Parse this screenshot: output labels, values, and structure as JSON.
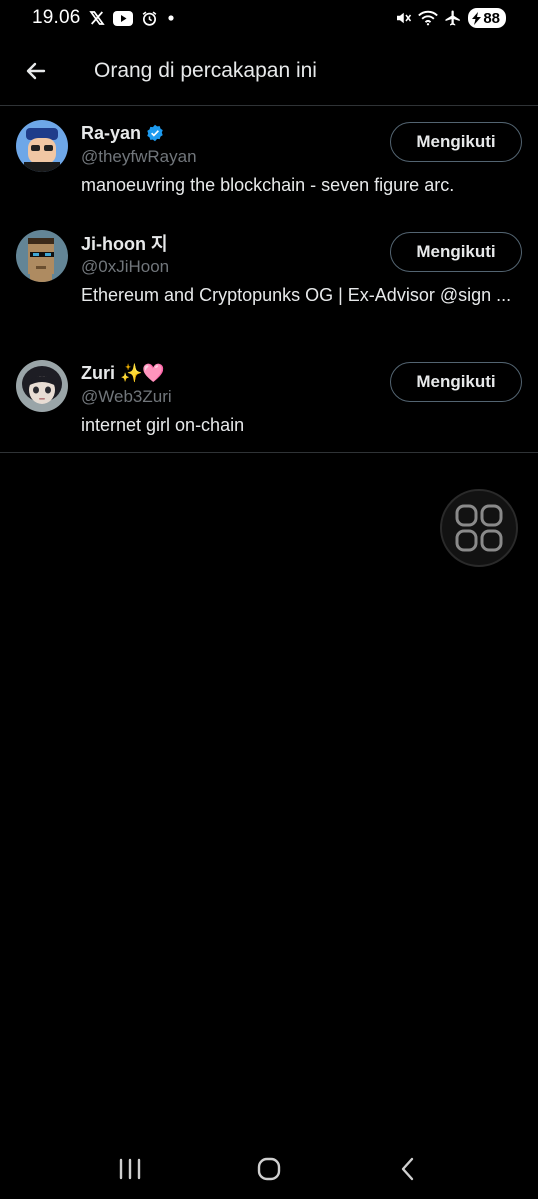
{
  "status_bar": {
    "time": "19.06",
    "battery": "88",
    "icons": [
      "x-icon",
      "youtube-icon",
      "alarm-icon",
      "dot-icon",
      "mute-icon",
      "wifi-icon",
      "airplane-icon",
      "battery-icon"
    ]
  },
  "header": {
    "title": "Orang di percakapan ini"
  },
  "users": [
    {
      "name": "Ra-yan",
      "verified": true,
      "handle": "@theyfwRayan",
      "bio": "manoeuvring the blockchain - seven figure arc.",
      "follow_label": "Mengikuti"
    },
    {
      "name": "Ji-hoon 지",
      "verified": false,
      "handle": "@0xJiHoon",
      "bio": "Ethereum and Cryptopunks OG |  Ex-Advisor @sign ...",
      "follow_label": "Mengikuti"
    },
    {
      "name": "Zuri ✨🩷",
      "verified": false,
      "handle": "@Web3Zuri",
      "bio": "internet girl on-chain",
      "follow_label": "Mengikuti"
    }
  ],
  "colors": {
    "background": "#000000",
    "text_primary": "#e7e9ea",
    "text_secondary": "#71767b",
    "divider": "#2f3336",
    "verified": "#1d9bf0"
  }
}
